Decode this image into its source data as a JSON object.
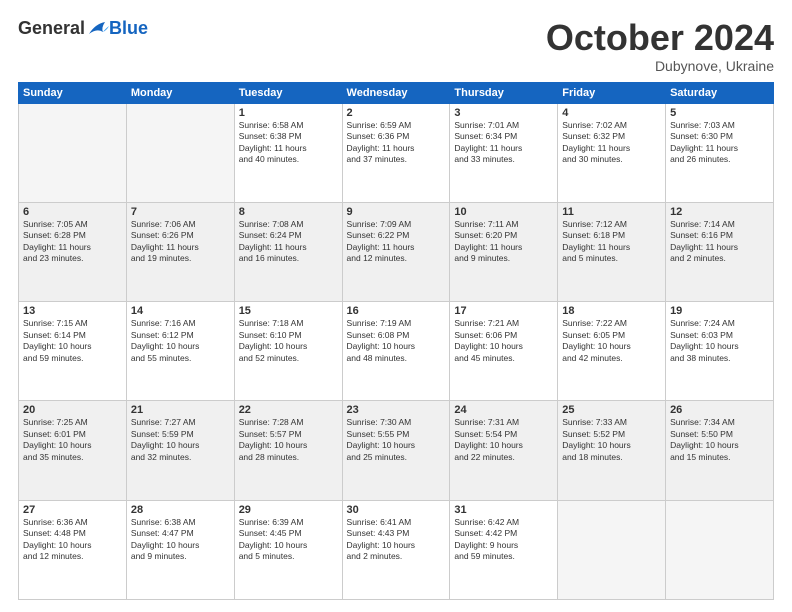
{
  "header": {
    "logo_general": "General",
    "logo_blue": "Blue",
    "title": "October 2024",
    "location": "Dubynove, Ukraine"
  },
  "weekdays": [
    "Sunday",
    "Monday",
    "Tuesday",
    "Wednesday",
    "Thursday",
    "Friday",
    "Saturday"
  ],
  "weeks": [
    [
      {
        "day": "",
        "info": ""
      },
      {
        "day": "",
        "info": ""
      },
      {
        "day": "1",
        "info": "Sunrise: 6:58 AM\nSunset: 6:38 PM\nDaylight: 11 hours\nand 40 minutes."
      },
      {
        "day": "2",
        "info": "Sunrise: 6:59 AM\nSunset: 6:36 PM\nDaylight: 11 hours\nand 37 minutes."
      },
      {
        "day": "3",
        "info": "Sunrise: 7:01 AM\nSunset: 6:34 PM\nDaylight: 11 hours\nand 33 minutes."
      },
      {
        "day": "4",
        "info": "Sunrise: 7:02 AM\nSunset: 6:32 PM\nDaylight: 11 hours\nand 30 minutes."
      },
      {
        "day": "5",
        "info": "Sunrise: 7:03 AM\nSunset: 6:30 PM\nDaylight: 11 hours\nand 26 minutes."
      }
    ],
    [
      {
        "day": "6",
        "info": "Sunrise: 7:05 AM\nSunset: 6:28 PM\nDaylight: 11 hours\nand 23 minutes."
      },
      {
        "day": "7",
        "info": "Sunrise: 7:06 AM\nSunset: 6:26 PM\nDaylight: 11 hours\nand 19 minutes."
      },
      {
        "day": "8",
        "info": "Sunrise: 7:08 AM\nSunset: 6:24 PM\nDaylight: 11 hours\nand 16 minutes."
      },
      {
        "day": "9",
        "info": "Sunrise: 7:09 AM\nSunset: 6:22 PM\nDaylight: 11 hours\nand 12 minutes."
      },
      {
        "day": "10",
        "info": "Sunrise: 7:11 AM\nSunset: 6:20 PM\nDaylight: 11 hours\nand 9 minutes."
      },
      {
        "day": "11",
        "info": "Sunrise: 7:12 AM\nSunset: 6:18 PM\nDaylight: 11 hours\nand 5 minutes."
      },
      {
        "day": "12",
        "info": "Sunrise: 7:14 AM\nSunset: 6:16 PM\nDaylight: 11 hours\nand 2 minutes."
      }
    ],
    [
      {
        "day": "13",
        "info": "Sunrise: 7:15 AM\nSunset: 6:14 PM\nDaylight: 10 hours\nand 59 minutes."
      },
      {
        "day": "14",
        "info": "Sunrise: 7:16 AM\nSunset: 6:12 PM\nDaylight: 10 hours\nand 55 minutes."
      },
      {
        "day": "15",
        "info": "Sunrise: 7:18 AM\nSunset: 6:10 PM\nDaylight: 10 hours\nand 52 minutes."
      },
      {
        "day": "16",
        "info": "Sunrise: 7:19 AM\nSunset: 6:08 PM\nDaylight: 10 hours\nand 48 minutes."
      },
      {
        "day": "17",
        "info": "Sunrise: 7:21 AM\nSunset: 6:06 PM\nDaylight: 10 hours\nand 45 minutes."
      },
      {
        "day": "18",
        "info": "Sunrise: 7:22 AM\nSunset: 6:05 PM\nDaylight: 10 hours\nand 42 minutes."
      },
      {
        "day": "19",
        "info": "Sunrise: 7:24 AM\nSunset: 6:03 PM\nDaylight: 10 hours\nand 38 minutes."
      }
    ],
    [
      {
        "day": "20",
        "info": "Sunrise: 7:25 AM\nSunset: 6:01 PM\nDaylight: 10 hours\nand 35 minutes."
      },
      {
        "day": "21",
        "info": "Sunrise: 7:27 AM\nSunset: 5:59 PM\nDaylight: 10 hours\nand 32 minutes."
      },
      {
        "day": "22",
        "info": "Sunrise: 7:28 AM\nSunset: 5:57 PM\nDaylight: 10 hours\nand 28 minutes."
      },
      {
        "day": "23",
        "info": "Sunrise: 7:30 AM\nSunset: 5:55 PM\nDaylight: 10 hours\nand 25 minutes."
      },
      {
        "day": "24",
        "info": "Sunrise: 7:31 AM\nSunset: 5:54 PM\nDaylight: 10 hours\nand 22 minutes."
      },
      {
        "day": "25",
        "info": "Sunrise: 7:33 AM\nSunset: 5:52 PM\nDaylight: 10 hours\nand 18 minutes."
      },
      {
        "day": "26",
        "info": "Sunrise: 7:34 AM\nSunset: 5:50 PM\nDaylight: 10 hours\nand 15 minutes."
      }
    ],
    [
      {
        "day": "27",
        "info": "Sunrise: 6:36 AM\nSunset: 4:48 PM\nDaylight: 10 hours\nand 12 minutes."
      },
      {
        "day": "28",
        "info": "Sunrise: 6:38 AM\nSunset: 4:47 PM\nDaylight: 10 hours\nand 9 minutes."
      },
      {
        "day": "29",
        "info": "Sunrise: 6:39 AM\nSunset: 4:45 PM\nDaylight: 10 hours\nand 5 minutes."
      },
      {
        "day": "30",
        "info": "Sunrise: 6:41 AM\nSunset: 4:43 PM\nDaylight: 10 hours\nand 2 minutes."
      },
      {
        "day": "31",
        "info": "Sunrise: 6:42 AM\nSunset: 4:42 PM\nDaylight: 9 hours\nand 59 minutes."
      },
      {
        "day": "",
        "info": ""
      },
      {
        "day": "",
        "info": ""
      }
    ]
  ]
}
